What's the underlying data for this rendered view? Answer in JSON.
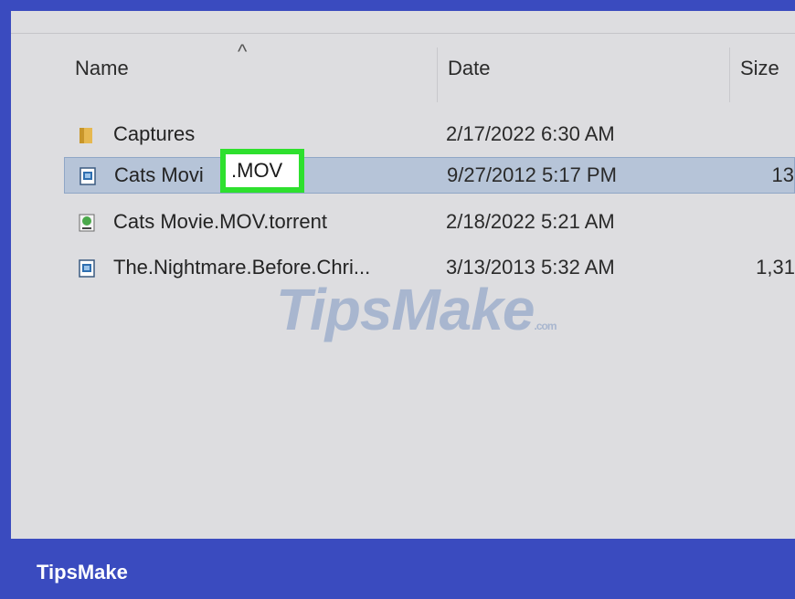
{
  "columns": {
    "name": "Name",
    "date": "Date",
    "size": "Size",
    "sort_indicator": "^"
  },
  "files": [
    {
      "name": "Captures",
      "date": "2/17/2022 6:30 AM",
      "size": "",
      "icon": "folder-icon"
    },
    {
      "name": "Cats Movi",
      "name_highlight": ".MOV",
      "date": "9/27/2012 5:17 PM",
      "size": "13",
      "icon": "video-file-icon",
      "selected": true
    },
    {
      "name": "Cats Movie.MOV.torrent",
      "date": "2/18/2022 5:21 AM",
      "size": "",
      "icon": "torrent-file-icon"
    },
    {
      "name": "The.Nightmare.Before.Chri...",
      "date": "3/13/2013 5:32 AM",
      "size": "1,31",
      "icon": "video-file-icon"
    }
  ],
  "watermark": {
    "main": "TipsMake",
    "suffix": ".com"
  },
  "footer": {
    "brand": "TipsMake"
  },
  "colors": {
    "frame_bg": "#3a4bbf",
    "list_bg": "#dddde0",
    "selection_bg": "#b6c4d8",
    "highlight_border": "#2ee02e"
  }
}
